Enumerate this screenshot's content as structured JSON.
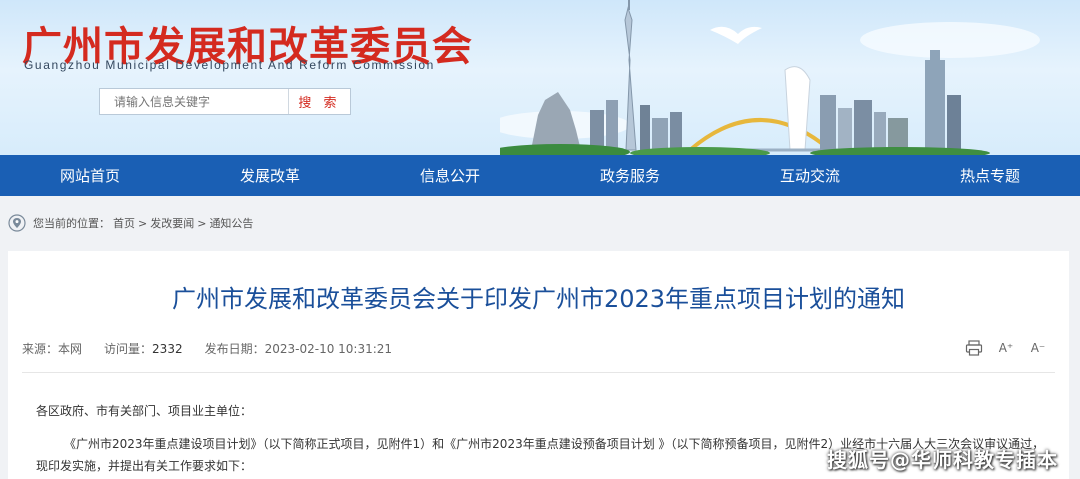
{
  "header": {
    "title": "广州市发展和改革委员会",
    "subtitle": "Guangzhou Municipal Development And Reform Commission",
    "search_placeholder": "请输入信息关键字",
    "search_button": "搜 索"
  },
  "nav": [
    {
      "label": "网站首页"
    },
    {
      "label": "发展改革"
    },
    {
      "label": "信息公开"
    },
    {
      "label": "政务服务"
    },
    {
      "label": "互动交流"
    },
    {
      "label": "热点专题"
    }
  ],
  "breadcrumb": {
    "prefix": "您当前的位置：",
    "items": [
      "首页",
      "发改要闻",
      "通知公告"
    ],
    "separator": ">"
  },
  "article": {
    "title": "广州市发展和改革委员会关于印发广州市2023年重点项目计划的通知",
    "source_label": "来源：",
    "source": "本网",
    "views_label": "访问量：",
    "views": "2332",
    "date_label": "发布日期：",
    "date": "2023-02-10 10:31:21",
    "salutation": "各区政府、市有关部门、项目业主单位：",
    "body": "《广州市2023年重点建设项目计划》（以下简称正式项目，见附件1）和《广州市2023年重点建设预备项目计划 》（以下简称预备项目，见附件2）业经市十六届人大三次会议审议通过，现印发实施，并提出有关工作要求如下："
  },
  "tools": {
    "print_icon": "printer-icon",
    "font_increase": "A⁺",
    "font_decrease": "A⁻"
  },
  "watermark": "搜狐号@华师科教专插本",
  "colors": {
    "brand_red": "#d42a1f",
    "nav_blue": "#1a5fb4",
    "title_blue": "#1a4f9a",
    "views_red": "#c0392b"
  }
}
